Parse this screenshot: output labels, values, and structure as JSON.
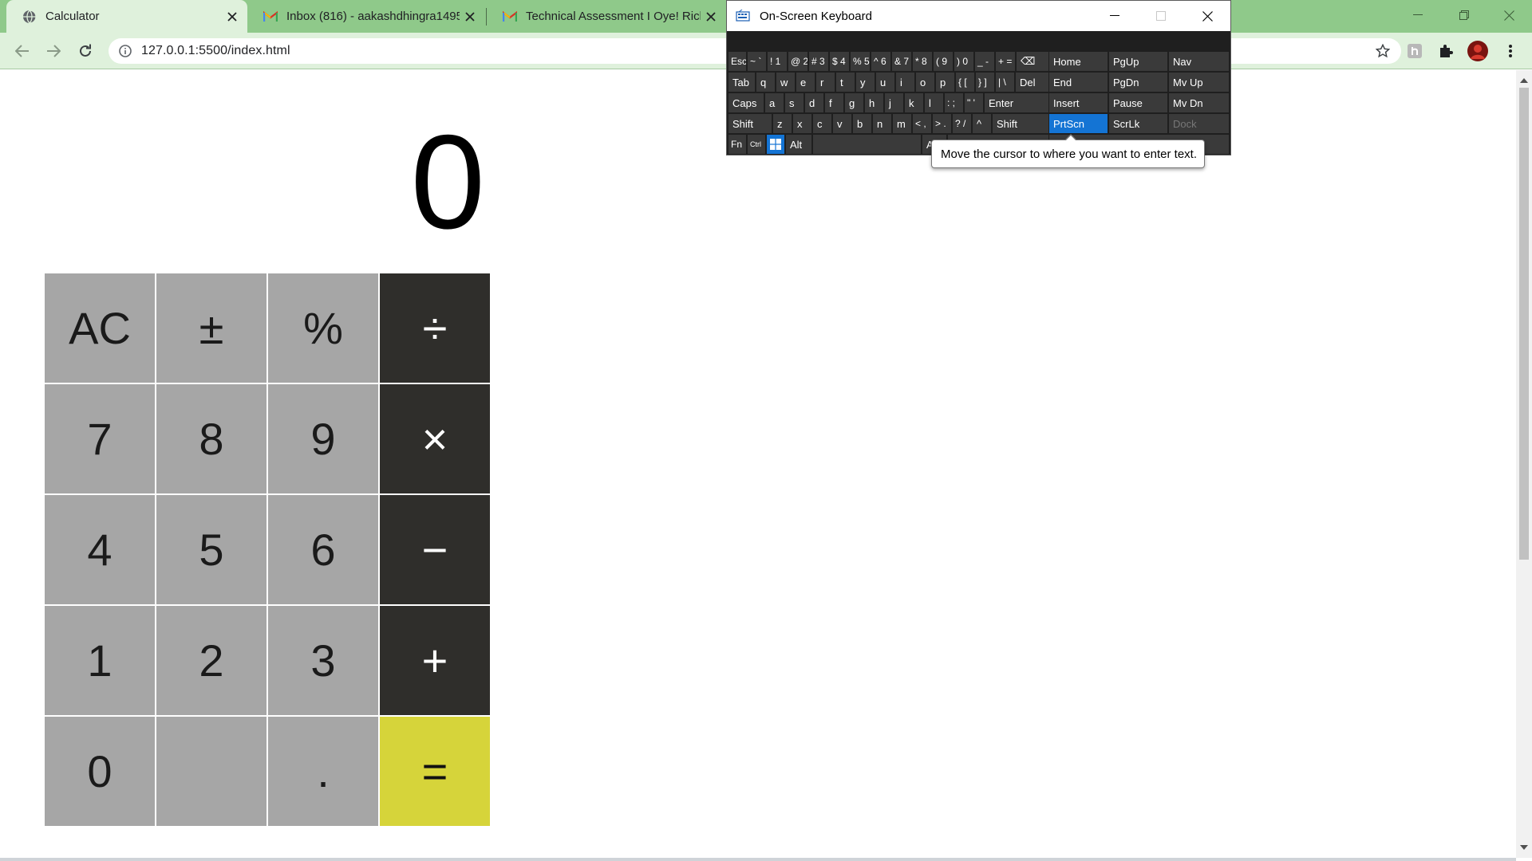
{
  "browser": {
    "tabs": [
      {
        "title": "Calculator",
        "favicon": "globe-icon"
      },
      {
        "title": "Inbox (816) - aakashdhingra1495",
        "favicon": "gmail-icon"
      },
      {
        "title": "Technical Assessment I Oye! Rickshaw",
        "favicon": "gmail-icon"
      }
    ],
    "url": "127.0.0.1:5500/index.html",
    "colors": {
      "frame": "#8fc98a",
      "toolbar": "#dff1dc"
    }
  },
  "calculator": {
    "display": "0",
    "keys": [
      {
        "label": "AC",
        "kind": "function"
      },
      {
        "label": "±",
        "kind": "function"
      },
      {
        "label": "%",
        "kind": "function"
      },
      {
        "label": "÷",
        "kind": "operator"
      },
      {
        "label": "7",
        "kind": "digit"
      },
      {
        "label": "8",
        "kind": "digit"
      },
      {
        "label": "9",
        "kind": "digit"
      },
      {
        "label": "×",
        "kind": "operator"
      },
      {
        "label": "4",
        "kind": "digit"
      },
      {
        "label": "5",
        "kind": "digit"
      },
      {
        "label": "6",
        "kind": "digit"
      },
      {
        "label": "−",
        "kind": "operator"
      },
      {
        "label": "1",
        "kind": "digit"
      },
      {
        "label": "2",
        "kind": "digit"
      },
      {
        "label": "3",
        "kind": "digit"
      },
      {
        "label": "+",
        "kind": "operator"
      },
      {
        "label": "0",
        "kind": "digit"
      },
      {
        "label": "",
        "kind": "blank"
      },
      {
        "label": ".",
        "kind": "digit"
      },
      {
        "label": "=",
        "kind": "equals"
      }
    ],
    "colors": {
      "key": "#a6a6a6",
      "operator": "#2f2e2b",
      "equals": "#d6d43a"
    }
  },
  "osk": {
    "title": "On-Screen Keyboard",
    "tooltip": "Move the cursor to where you want to enter text.",
    "rows": [
      [
        "Esc",
        "~ `",
        "! 1",
        "@ 2",
        "# 3",
        "$ 4",
        "% 5",
        "^ 6",
        "& 7",
        "* 8",
        "( 9",
        ") 0",
        "_ -",
        "+ =",
        "⌫"
      ],
      [
        "Tab",
        "q",
        "w",
        "e",
        "r",
        "t",
        "y",
        "u",
        "i",
        "o",
        "p",
        "{ [",
        "} ]",
        "| \\",
        "Del"
      ],
      [
        "Caps",
        "a",
        "s",
        "d",
        "f",
        "g",
        "h",
        "j",
        "k",
        "l",
        ": ;",
        "\" '",
        "Enter"
      ],
      [
        "Shift",
        "z",
        "x",
        "c",
        "v",
        "b",
        "n",
        "m",
        "< ,",
        "> .",
        "? /",
        "^",
        "Shift"
      ],
      [
        "Fn",
        "Ctrl",
        "Win",
        "Alt",
        "",
        "Alt"
      ]
    ],
    "side": [
      [
        "Home",
        "PgUp",
        "Nav"
      ],
      [
        "End",
        "PgDn",
        "Mv Up"
      ],
      [
        "Insert",
        "Pause",
        "Mv Dn"
      ],
      [
        "PrtScn",
        "ScrLk",
        "Dock"
      ]
    ],
    "highlighted": "PrtScn",
    "highlight_color": "#1474d4"
  }
}
